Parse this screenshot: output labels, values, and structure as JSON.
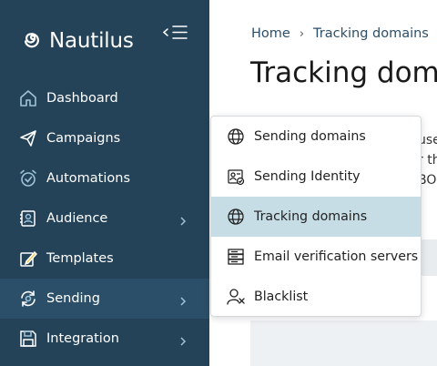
{
  "brand": {
    "name": "Nautilus",
    "logo_icon": "spiral-logo-icon"
  },
  "sidebar": {
    "collapse_icon": "menu-collapse-icon",
    "items": [
      {
        "label": "Dashboard",
        "icon": "home-icon",
        "has_submenu": false
      },
      {
        "label": "Campaigns",
        "icon": "paper-plane-icon",
        "has_submenu": false
      },
      {
        "label": "Automations",
        "icon": "alarm-clock-icon",
        "has_submenu": false
      },
      {
        "label": "Audience",
        "icon": "contact-card-icon",
        "has_submenu": true
      },
      {
        "label": "Templates",
        "icon": "pencil-note-icon",
        "has_submenu": false
      },
      {
        "label": "Sending",
        "icon": "sync-globe-icon",
        "has_submenu": true,
        "active": true
      },
      {
        "label": "Integration",
        "icon": "floppy-disk-icon",
        "has_submenu": true
      }
    ]
  },
  "breadcrumb": {
    "home": "Home",
    "separator": "›",
    "current": "Tracking domains"
  },
  "page": {
    "title": "Tracking domains"
  },
  "background_fragments": [
    "use",
    "r th",
    "BO"
  ],
  "dropdown": {
    "items": [
      {
        "label": "Sending domains",
        "icon": "globe-icon"
      },
      {
        "label": "Sending Identity",
        "icon": "id-card-check-icon"
      },
      {
        "label": "Tracking domains",
        "icon": "globe-icon",
        "active": true
      },
      {
        "label": "Email verification servers",
        "icon": "server-icon"
      },
      {
        "label": "Blacklist",
        "icon": "user-block-icon"
      }
    ]
  },
  "colors": {
    "sidebar_bg": "#244359",
    "sidebar_active": "#2b4f68",
    "menu_highlight": "#c7dde6",
    "link": "#2b4f68"
  }
}
